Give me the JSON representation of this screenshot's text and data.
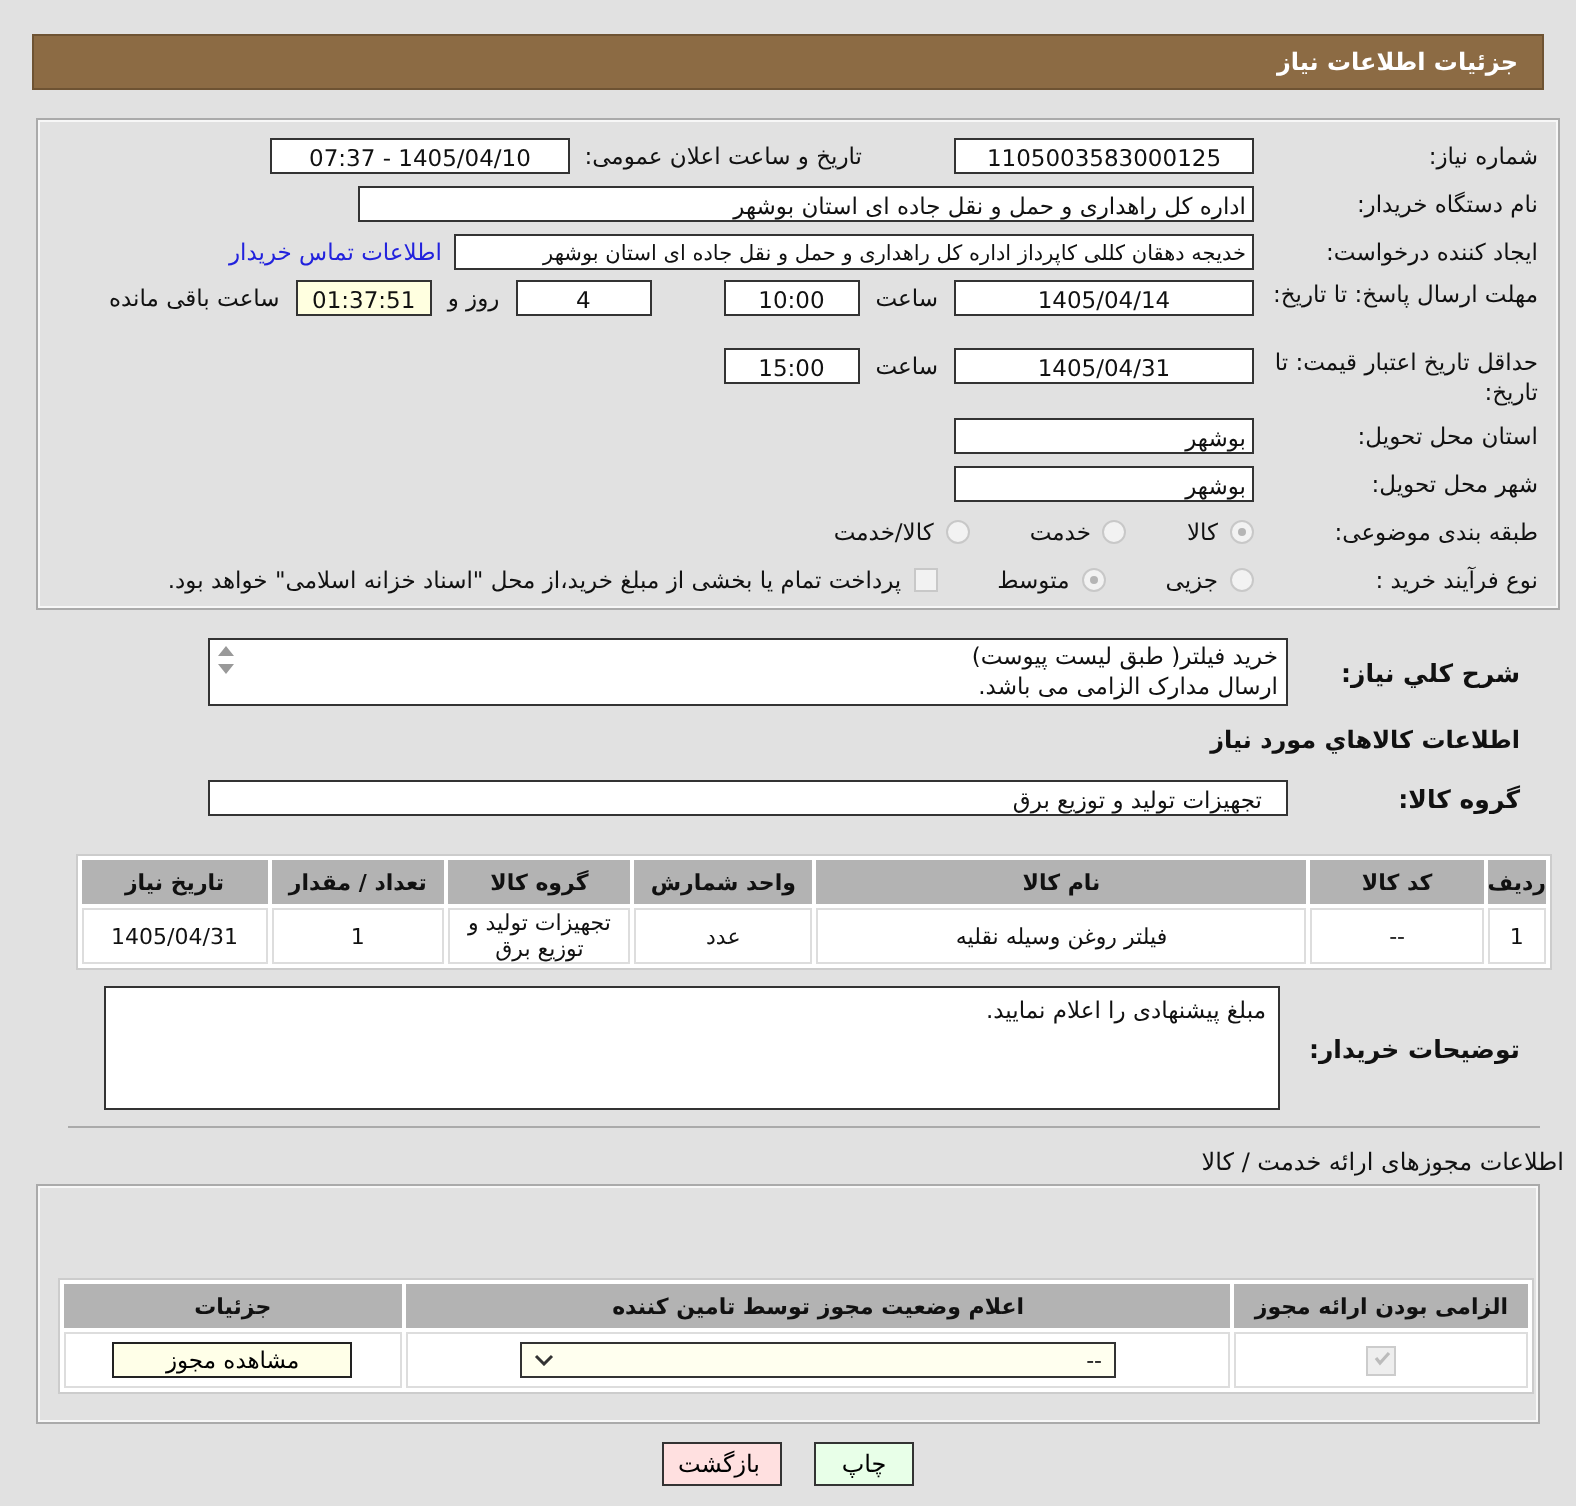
{
  "header": {
    "title": "جزئیات اطلاعات نیاز"
  },
  "need_number": {
    "label": "شماره نیاز:",
    "value": "1105003583000125"
  },
  "announce": {
    "label": "تاریخ و ساعت اعلان عمومی:",
    "value": "1405/04/10 - 07:37"
  },
  "buyer": {
    "label": "نام دستگاه خریدار:",
    "value": "اداره کل راهداری و حمل و نقل جاده ای استان بوشهر"
  },
  "requester": {
    "label": "ایجاد کننده درخواست:",
    "value": "خدیجه دهقان کللی کاپرداز اداره کل راهداری و حمل و نقل جاده ای استان بوشهر",
    "link": "اطلاعات تماس خریدار"
  },
  "reply_deadline": {
    "label": "مهلت ارسال پاسخ: تا تاریخ:",
    "date": "1405/04/14",
    "time_label": "ساعت",
    "time": "10:00",
    "days": "4",
    "days_label": "روز و",
    "remaining": "01:37:51",
    "remaining_label": "ساعت باقی مانده"
  },
  "price_validity": {
    "label": "حداقل تاریخ اعتبار قیمت: تا تاریخ:",
    "date": "1405/04/31",
    "time_label": "ساعت",
    "time": "15:00"
  },
  "province": {
    "label": "استان محل تحویل:",
    "value": "بوشهر"
  },
  "city": {
    "label": "شهر محل تحویل:",
    "value": "بوشهر"
  },
  "category": {
    "label": "طبقه بندی موضوعی:",
    "options": [
      {
        "label": "کالا",
        "selected": true
      },
      {
        "label": "خدمت",
        "selected": false
      },
      {
        "label": "کالا/خدمت",
        "selected": false
      }
    ]
  },
  "process": {
    "label": "نوع فرآیند خرید :",
    "options": [
      {
        "label": "جزیی",
        "selected": false
      },
      {
        "label": "متوسط",
        "selected": true
      }
    ],
    "payment": {
      "label": "پرداخت تمام یا بخشی از مبلغ خرید،از محل \"اسناد خزانه اسلامی\" خواهد بود.",
      "checked": false
    }
  },
  "description": {
    "label": "شرح کلي نياز:",
    "lines": [
      "خريد فيلتر( طبق ليست پيوست)",
      "ارسال مدارک الزامی می باشد."
    ]
  },
  "goods_title": "اطلاعات کالاهاي مورد نياز",
  "goods_group": {
    "label": "گروه کالا:",
    "value": "تجهیزات تولید و توزیع برق"
  },
  "goods_table": {
    "columns": [
      "ردیف",
      "کد کالا",
      "نام کالا",
      "واحد شمارش",
      "گروه کالا",
      "تعداد / مقدار",
      "تاریخ نیاز"
    ],
    "rows": [
      [
        "1",
        "--",
        "فیلتر روغن وسیله نقلیه",
        "عدد",
        "تجهیزات تولید و توزیع برق",
        "1",
        "1405/04/31"
      ]
    ]
  },
  "buyer_notes": {
    "label": "توضیحات خریدار:",
    "value": "مبلغ پیشنهادی را اعلام نمایید."
  },
  "permits": {
    "title": "اطلاعات مجوزهای ارائه خدمت / کالا",
    "columns": [
      "الزامی بودن ارائه مجوز",
      "اعلام وضعیت مجوز توسط تامین کننده",
      "جزئیات"
    ],
    "rows": [
      {
        "required": true,
        "status": "--",
        "details": "مشاهده مجوز"
      }
    ]
  },
  "buttons": [
    {
      "label": "چاپ",
      "kind": "print"
    },
    {
      "label": "بازگشت",
      "kind": "back"
    }
  ]
}
